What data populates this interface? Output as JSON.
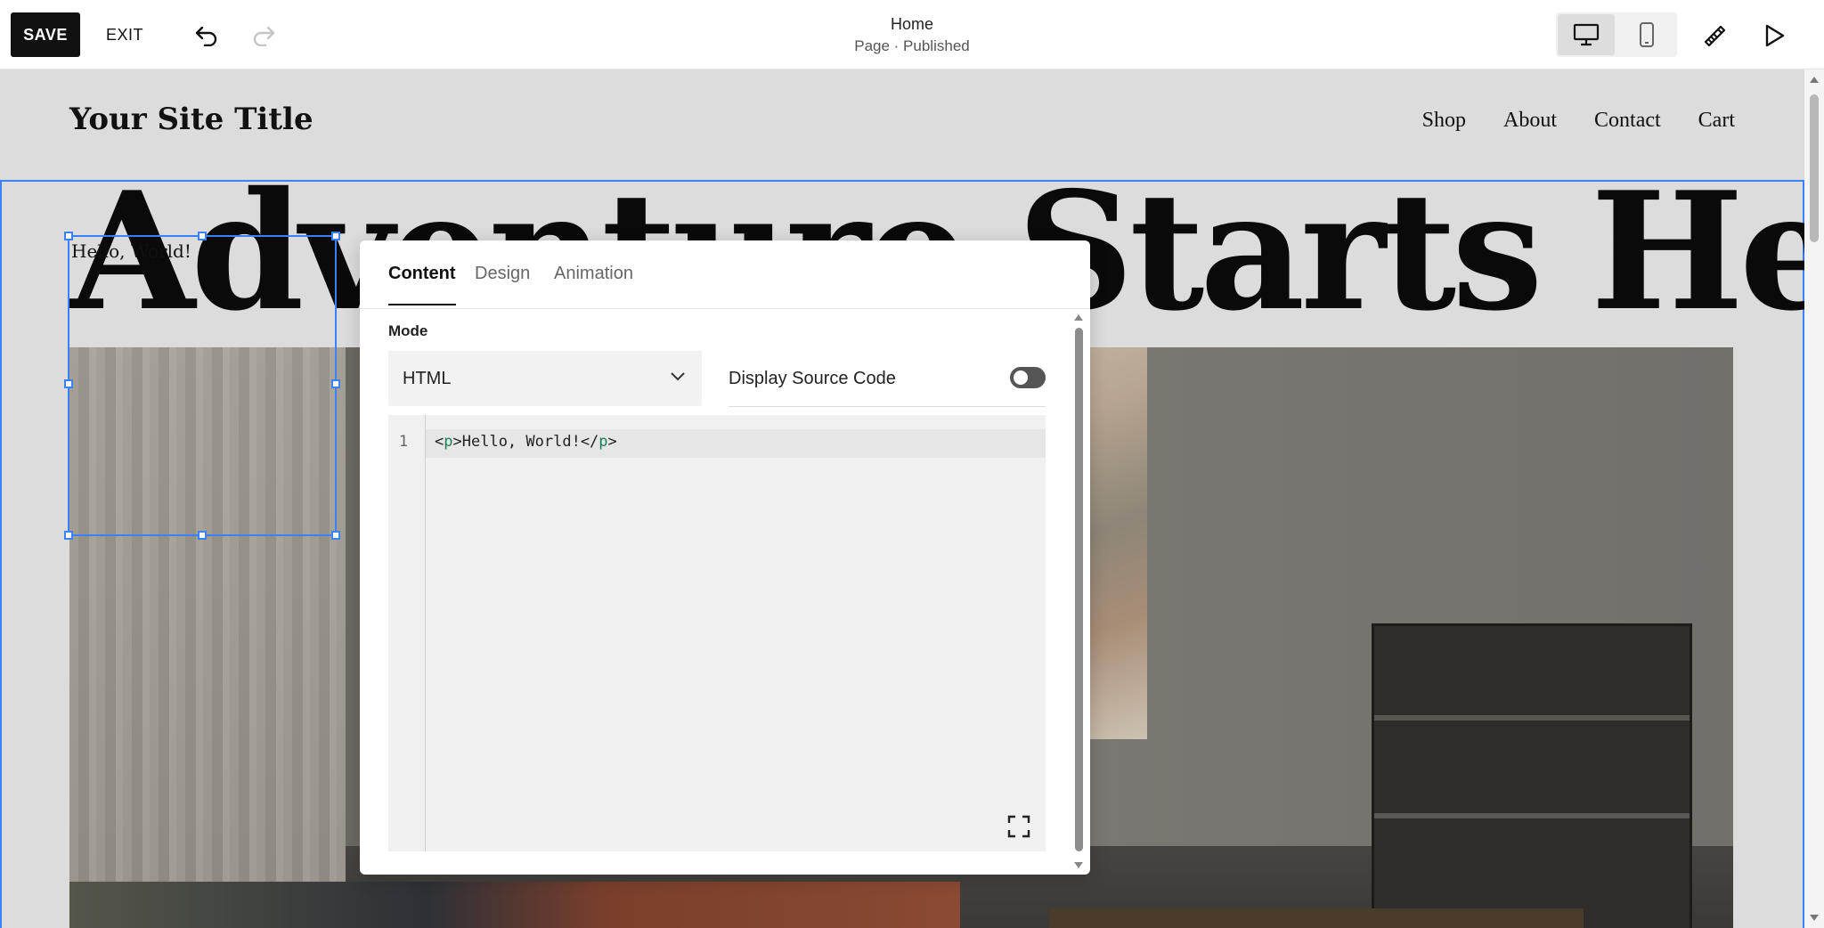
{
  "toolbar": {
    "save_label": "SAVE",
    "exit_label": "EXIT",
    "page_name": "Home",
    "page_status": "Page · Published"
  },
  "site": {
    "title": "Your Site Title",
    "nav": [
      "Shop",
      "About",
      "Contact",
      "Cart"
    ],
    "headline": "Adventure Starts Here",
    "code_block_text": "Hello, World!"
  },
  "panel": {
    "tabs": [
      {
        "label": "Content",
        "active": true
      },
      {
        "label": "Design",
        "active": false
      },
      {
        "label": "Animation",
        "active": false
      }
    ],
    "mode_label": "Mode",
    "mode_value": "HTML",
    "display_source_label": "Display Source Code",
    "display_source_on": false,
    "editor": {
      "line_number": "1",
      "code": "<p>Hello, World!</p>"
    }
  },
  "colors": {
    "selection": "#3b82f6",
    "save_bg": "#111111",
    "tag_color": "#1a7f54"
  }
}
